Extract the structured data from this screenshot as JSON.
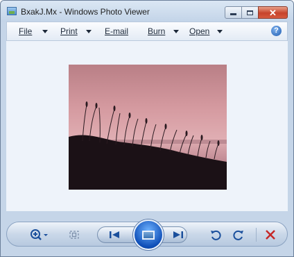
{
  "window": {
    "title": "BxakJ.Mx - Windows Photo Viewer"
  },
  "menu": {
    "file": "File",
    "print": "Print",
    "email": "E-mail",
    "burn": "Burn",
    "open": "Open",
    "help": "?"
  },
  "colors": {
    "close_button": "#c7432b",
    "accent": "#1e5bb0"
  },
  "icons": {
    "zoom": "magnifier-plus-icon",
    "fit": "actual-size-icon",
    "previous": "previous-icon",
    "slideshow": "slideshow-icon",
    "next": "next-icon",
    "rotate_ccw": "rotate-counterclockwise-icon",
    "rotate_cw": "rotate-clockwise-icon",
    "delete": "delete-icon"
  }
}
